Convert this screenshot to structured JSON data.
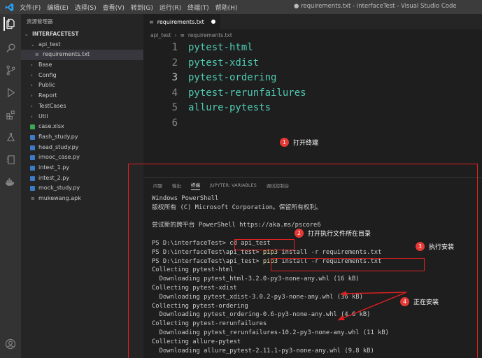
{
  "titlebar": {
    "menu": [
      "文件(F)",
      "编辑(E)",
      "选择(S)",
      "查看(V)",
      "转到(G)",
      "运行(R)",
      "终端(T)",
      "帮助(H)"
    ],
    "window_title": "● requirements.txt - interfaceTest - Visual Studio Code"
  },
  "sidebar": {
    "header": "资源管理器",
    "project": "INTERFACETEST",
    "items": [
      {
        "label": "api_test",
        "type": "folder-open"
      },
      {
        "label": "requirements.txt",
        "type": "file-txt"
      },
      {
        "label": "Base",
        "type": "folder"
      },
      {
        "label": "Config",
        "type": "folder"
      },
      {
        "label": "Public",
        "type": "folder"
      },
      {
        "label": "Report",
        "type": "folder"
      },
      {
        "label": "TestCases",
        "type": "folder"
      },
      {
        "label": "Util",
        "type": "folder"
      },
      {
        "label": "case.xlsx",
        "type": "file-xlsx"
      },
      {
        "label": "flash_study.py",
        "type": "file-py"
      },
      {
        "label": "head_study.py",
        "type": "file-py"
      },
      {
        "label": "imooc_case.py",
        "type": "file-py"
      },
      {
        "label": "intest_1.py",
        "type": "file-py"
      },
      {
        "label": "intest_2.py",
        "type": "file-py"
      },
      {
        "label": "mock_study.py",
        "type": "file-py"
      },
      {
        "label": "mukewang.apk",
        "type": "file-apk"
      }
    ]
  },
  "editor": {
    "tab_label": "requirements.txt",
    "breadcrumb": [
      "api_test",
      "requirements.txt"
    ],
    "lines": [
      {
        "n": "1",
        "text": "pytest-html"
      },
      {
        "n": "2",
        "text": "pytest-xdist"
      },
      {
        "n": "3",
        "text": "pytest-ordering"
      },
      {
        "n": "4",
        "text": "pytest-rerunfailures"
      },
      {
        "n": "5",
        "text": "allure-pytests"
      },
      {
        "n": "6",
        "text": ""
      }
    ]
  },
  "panel": {
    "tabs": [
      "问题",
      "输出",
      "终端",
      "JUPYTER: VARIABLES",
      "调试控制台"
    ],
    "active_tab": "终端",
    "terminal": {
      "l1": "Windows PowerShell",
      "l2": "版权所有 (C) Microsoft Corporation。保留所有权利。",
      "l3": "尝试新的跨平台 PowerShell https://aka.ms/pscore6",
      "l4_prompt": "PS D:\\interfaceTest> ",
      "l4_cmd": "cd api_test",
      "l5_prompt": "PS D:\\interfaceTest\\api_test> ",
      "l5_cmd": "pip3",
      "l5_rest": " install -r requirements.txt",
      "l6_prompt": "PS D:\\interfaceTest\\api_test> ",
      "l6_cmd": "pip3",
      "l6_rest": " install -r requirements.txt",
      "l7": "Collecting pytest-html",
      "l8": "  Downloading pytest_html-3.2.0-py3-none-any.whl (16 kB)",
      "l9": "Collecting pytest-xdist",
      "l10": "  Downloading pytest_xdist-3.0.2-py3-none-any.whl (36 kB)",
      "l11": "Collecting pytest-ordering",
      "l12": "  Downloading pytest_ordering-0.6-py3-none-any.whl (4.6 kB)",
      "l13": "Collecting pytest-rerunfailures",
      "l14": "  Downloading pytest_rerunfailures-10.2-py3-none-any.whl (11 kB)",
      "l15": "Collecting allure-pytest",
      "l16": "  Downloading allure_pytest-2.11.1-py3-none-any.whl (9.8 kB)"
    }
  },
  "annotations": {
    "a1": {
      "num": "1",
      "text": "打开终端"
    },
    "a2": {
      "num": "2",
      "text": "打开执行文件所在目录"
    },
    "a3": {
      "num": "3",
      "text": "执行安装"
    },
    "a4": {
      "num": "4",
      "text": "正在安装"
    }
  },
  "colors": {
    "accent_red": "#e02020",
    "badge_red": "#e53935",
    "code_teal": "#4ec9b0",
    "cmd_yellow": "#dcdcaa"
  }
}
